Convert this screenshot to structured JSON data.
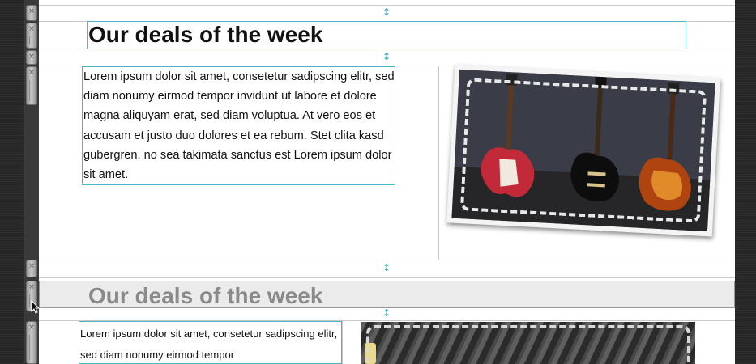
{
  "blocks": [
    {
      "heading": "Our deals of the week",
      "body": "Lorem ipsum dolor sit amet, consetetur sadipscing elitr, sed diam nonumy eirmod tempor invidunt ut labore et dolore magna aliquyam erat, sed diam voluptua. At vero eos et accusam et justo duo dolores et ea rebum. Stet clita kasd gubergren, no sea takimata sanctus est Lorem ipsum dolor sit amet.",
      "image": "guitars-photo"
    },
    {
      "heading": "Our deals of the week",
      "body": "Lorem ipsum dolor sit amet, consetetur sadipscing elitr, sed diam nonumy eirmod tempor",
      "image": "guitar-closeup-photo"
    }
  ],
  "icons": {
    "remove": "×",
    "resize": "↕"
  },
  "colors": {
    "selection_outline": "#49b8c6",
    "resize_arrow": "#1aa6b7",
    "selected_row_bg": "#ebebeb",
    "dimmed_heading": "#8a8a8a"
  }
}
